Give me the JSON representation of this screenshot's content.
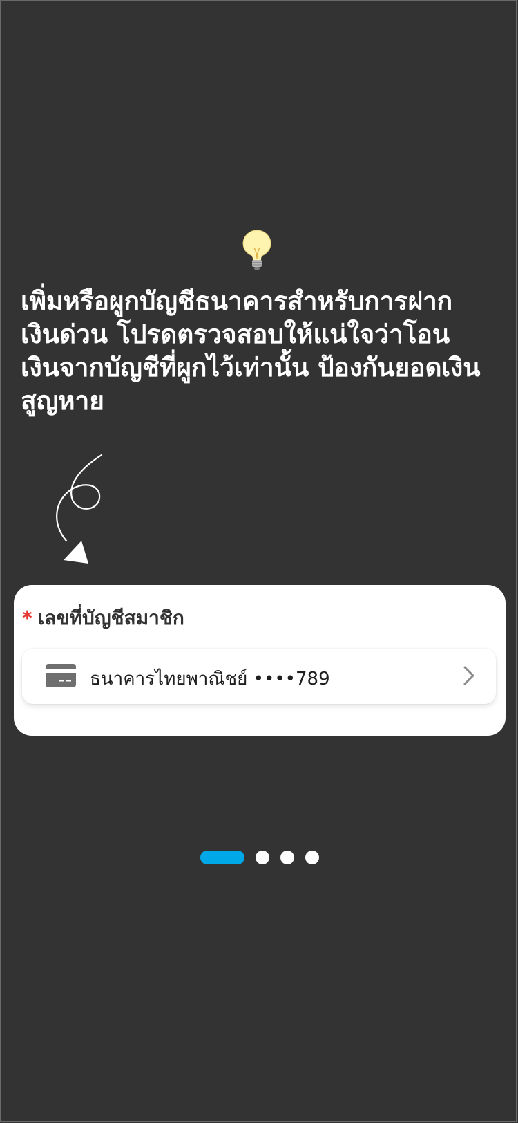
{
  "tip": {
    "icon": "lightbulb-icon",
    "emoji": "💡",
    "text": "เพิ่มหรือผูกบัญชีธนาคารสำหรับการฝาก\nเงินด่วน โปรดตรวจสอบให้แน่ใจว่าโอน\nเงินจากบัญชีที่ผูกไว้เท่านั้น ป้องกันยอดเงิน\nสูญหาย"
  },
  "card": {
    "required_mark": "*",
    "label": "เลขที่บัญชีสมาชิก",
    "selector": {
      "icon": "credit-card-icon",
      "text": "ธนาคารไทยพาณิชย์ ••••789",
      "chevron": "chevron-right-icon"
    }
  },
  "pager": {
    "total": 4,
    "active_index": 0,
    "active_color": "#00a8e8",
    "inactive_color": "#ffffff"
  }
}
